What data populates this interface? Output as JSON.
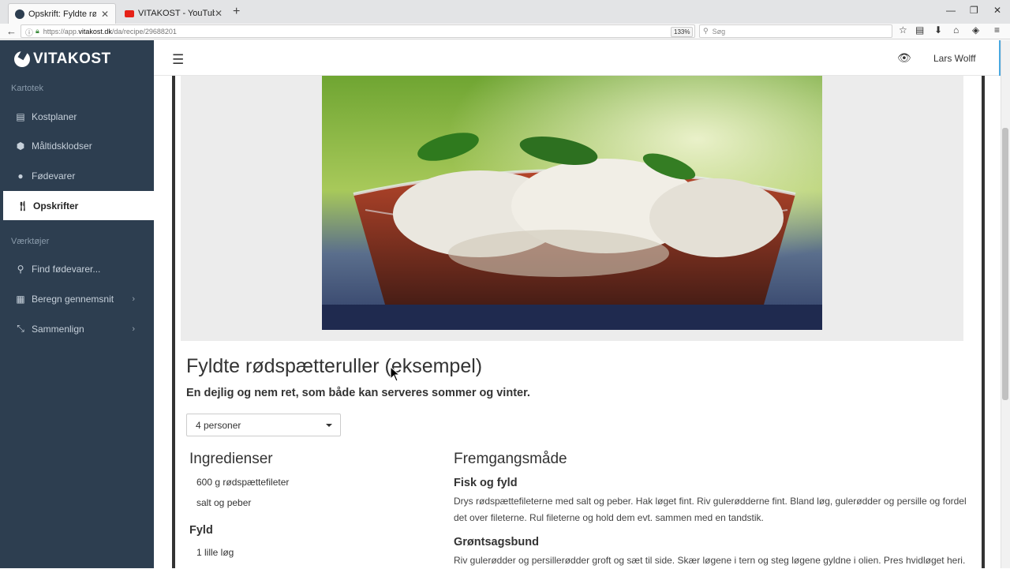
{
  "browser": {
    "tabs": [
      {
        "title": "Opskrift: Fyldte rødspætteru",
        "active": true
      },
      {
        "title": "VITAKOST - YouTube",
        "active": false
      }
    ],
    "url_prefix": "https://app.",
    "url_domain": "vitakost.dk",
    "url_path": "/da/recipe/29688201",
    "zoom": "133%",
    "search_placeholder": "Søg"
  },
  "sidebar": {
    "logo": "VITAKOST",
    "section_kartotek": "Kartotek",
    "items": [
      {
        "label": "Kostplaner",
        "icon": "list-icon"
      },
      {
        "label": "Måltidsklodser",
        "icon": "cube-icon"
      },
      {
        "label": "Fødevarer",
        "icon": "apple-icon"
      },
      {
        "label": "Opskrifter",
        "icon": "cutlery-icon"
      }
    ],
    "section_vaerktojer": "Værktøjer",
    "tools": [
      {
        "label": "Find fødevarer...",
        "icon": "search-icon"
      },
      {
        "label": "Beregn gennemsnit",
        "icon": "calculator-icon"
      },
      {
        "label": "Sammenlign",
        "icon": "compare-icon"
      }
    ]
  },
  "header": {
    "user": "Lars Wolff"
  },
  "recipe": {
    "title": "Fyldte rødspætteruller (eksempel)",
    "subtitle": "En dejlig og nem ret, som både kan serveres sommer og vinter.",
    "servings": "4 personer",
    "ingredients_heading": "Ingredienser",
    "ingredients": [
      "600 g rødspættefileter",
      "salt og peber"
    ],
    "fyld_heading": "Fyld",
    "fyld": [
      "1 lille løg"
    ],
    "method_heading": "Fremgangsmåde",
    "steps": [
      {
        "heading": "Fisk og fyld",
        "text": "Drys rødspættefileterne med salt og peber. Hak løget fint. Riv gulerødderne fint. Bland løg, gulerødder og persille og fordel det over fileterne. Rul fileterne og hold dem evt. sammen med en tandstik."
      },
      {
        "heading": "Grøntsagsbund",
        "text": "Riv gulerødder og persillerødder groft og sæt til side. Skær løgene i tern og steg løgene gyldne i olien. Pres hvidløget heri."
      }
    ]
  },
  "colors": {
    "sidebar_bg": "#2d3e50",
    "accent": "#4aa8e0"
  }
}
